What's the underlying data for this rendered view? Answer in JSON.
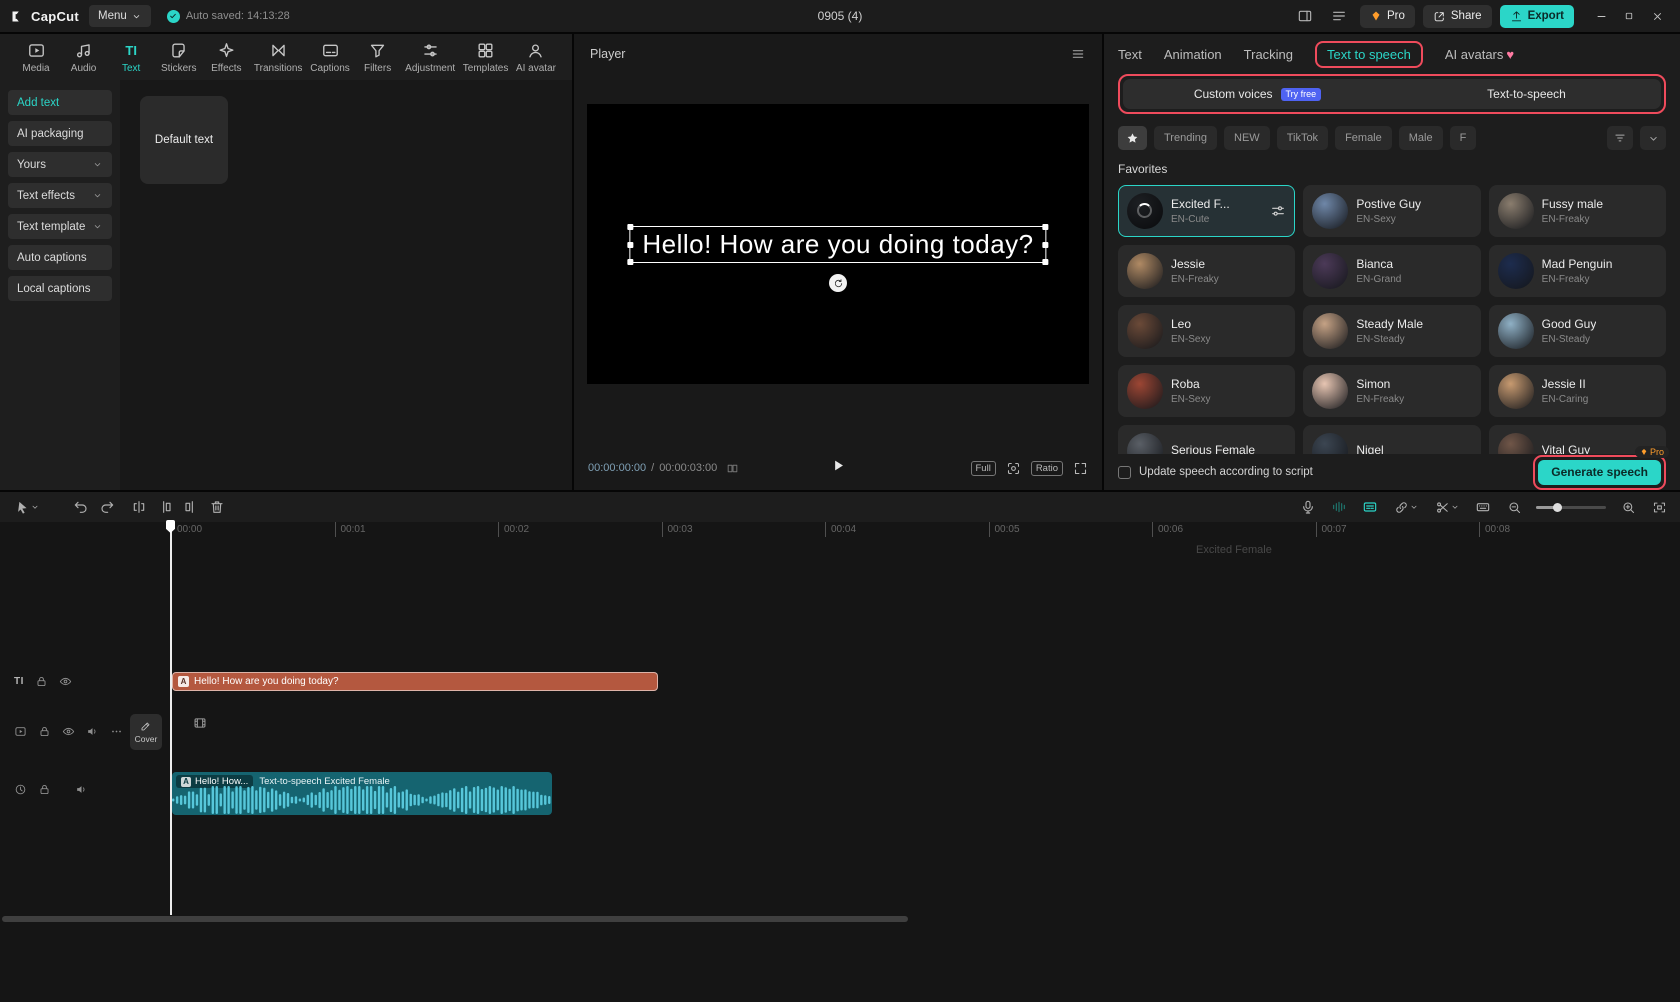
{
  "colors": {
    "accent": "#2bd6c8",
    "highlight": "#ef4b5c",
    "text_clip": "#b4583f",
    "audio_clip": "#156470",
    "waveform": "#5fd2e6"
  },
  "titlebar": {
    "app_name": "CapCut",
    "menu_label": "Menu",
    "autosave_text": "Auto saved: 14:13:28",
    "project_title": "0905 (4)",
    "pro_label": "Pro",
    "share_label": "Share",
    "export_label": "Export"
  },
  "ribbon": {
    "text_icon": "TI",
    "items": [
      {
        "label": "Media"
      },
      {
        "label": "Audio"
      },
      {
        "label": "Text"
      },
      {
        "label": "Stickers"
      },
      {
        "label": "Effects"
      },
      {
        "label": "Transitions"
      },
      {
        "label": "Captions"
      },
      {
        "label": "Filters"
      },
      {
        "label": "Adjustment"
      },
      {
        "label": "Templates"
      },
      {
        "label": "AI avatar"
      }
    ]
  },
  "sidebar": {
    "items": [
      {
        "label": "Add text"
      },
      {
        "label": "AI packaging"
      },
      {
        "label": "Yours"
      },
      {
        "label": "Text effects"
      },
      {
        "label": "Text template"
      },
      {
        "label": "Auto captions"
      },
      {
        "label": "Local captions"
      }
    ]
  },
  "library": {
    "card_label": "Default text"
  },
  "player": {
    "title": "Player",
    "overlay_text": "Hello! How are you doing today?",
    "current_time": "00:00:00:00",
    "separator": "/",
    "duration": "00:00:03:00",
    "full_label": "Full",
    "ratio_label": "Ratio"
  },
  "voice_panel": {
    "tabs": [
      {
        "label": "Text"
      },
      {
        "label": "Animation"
      },
      {
        "label": "Tracking"
      },
      {
        "label": "Text to speech"
      },
      {
        "label": "AI avatars",
        "heart": "♥"
      }
    ],
    "segments": {
      "left_label": "Custom voices",
      "badge": "Try free",
      "right_label": "Text-to-speech"
    },
    "filters": [
      "Trending",
      "NEW",
      "TikTok",
      "Female",
      "Male",
      "F"
    ],
    "section_title": "Favorites",
    "voices": [
      {
        "name": "Excited F...",
        "tag": "EN-Cute",
        "selected": true,
        "loading": true,
        "color": "#3a3f46"
      },
      {
        "name": "Postive Guy",
        "tag": "EN-Sexy",
        "color": "#6f87a8"
      },
      {
        "name": "Fussy male",
        "tag": "EN-Freaky",
        "color": "#8a7d6e"
      },
      {
        "name": "Jessie",
        "tag": "EN-Freaky",
        "color": "#b08a64"
      },
      {
        "name": "Bianca",
        "tag": "EN-Grand",
        "color": "#4c3a58"
      },
      {
        "name": "Mad Penguin",
        "tag": "EN-Freaky",
        "color": "#1d2c4e"
      },
      {
        "name": "Leo",
        "tag": "EN-Sexy",
        "color": "#6b4a38"
      },
      {
        "name": "Steady Male",
        "tag": "EN-Steady",
        "color": "#c5a285"
      },
      {
        "name": "Good Guy",
        "tag": "EN-Steady",
        "color": "#8fb0c5"
      },
      {
        "name": "Roba",
        "tag": "EN-Sexy",
        "color": "#9c4634"
      },
      {
        "name": "Simon",
        "tag": "EN-Freaky",
        "color": "#e7c5b2"
      },
      {
        "name": "Jessie II",
        "tag": "EN-Caring",
        "color": "#c79a70"
      },
      {
        "name": "Serious Female",
        "tag": "",
        "color": "#5a5f66"
      },
      {
        "name": "Nigel",
        "tag": "",
        "color": "#3c4652"
      },
      {
        "name": "Vital Guy",
        "tag": "",
        "color": "#705648"
      }
    ],
    "footer": {
      "checkbox_label": "Update speech according to script",
      "generate_label": "Generate speech",
      "pro_badge": "Pro"
    }
  },
  "timeline": {
    "ruler_labels": [
      "00:00",
      "00:01",
      "00:02",
      "00:03",
      "00:04",
      "00:05",
      "00:06",
      "00:07",
      "00:08"
    ],
    "cover_label": "Cover",
    "text_track_badge": "TI",
    "clip_icon_glyph": "A",
    "text_clip_label": "Hello! How are you doing today?",
    "audio_badge_label": "Hello! How...",
    "audio_clip_label": "Text-to-speech Excited Female",
    "ghost_label": "Excited Female"
  }
}
